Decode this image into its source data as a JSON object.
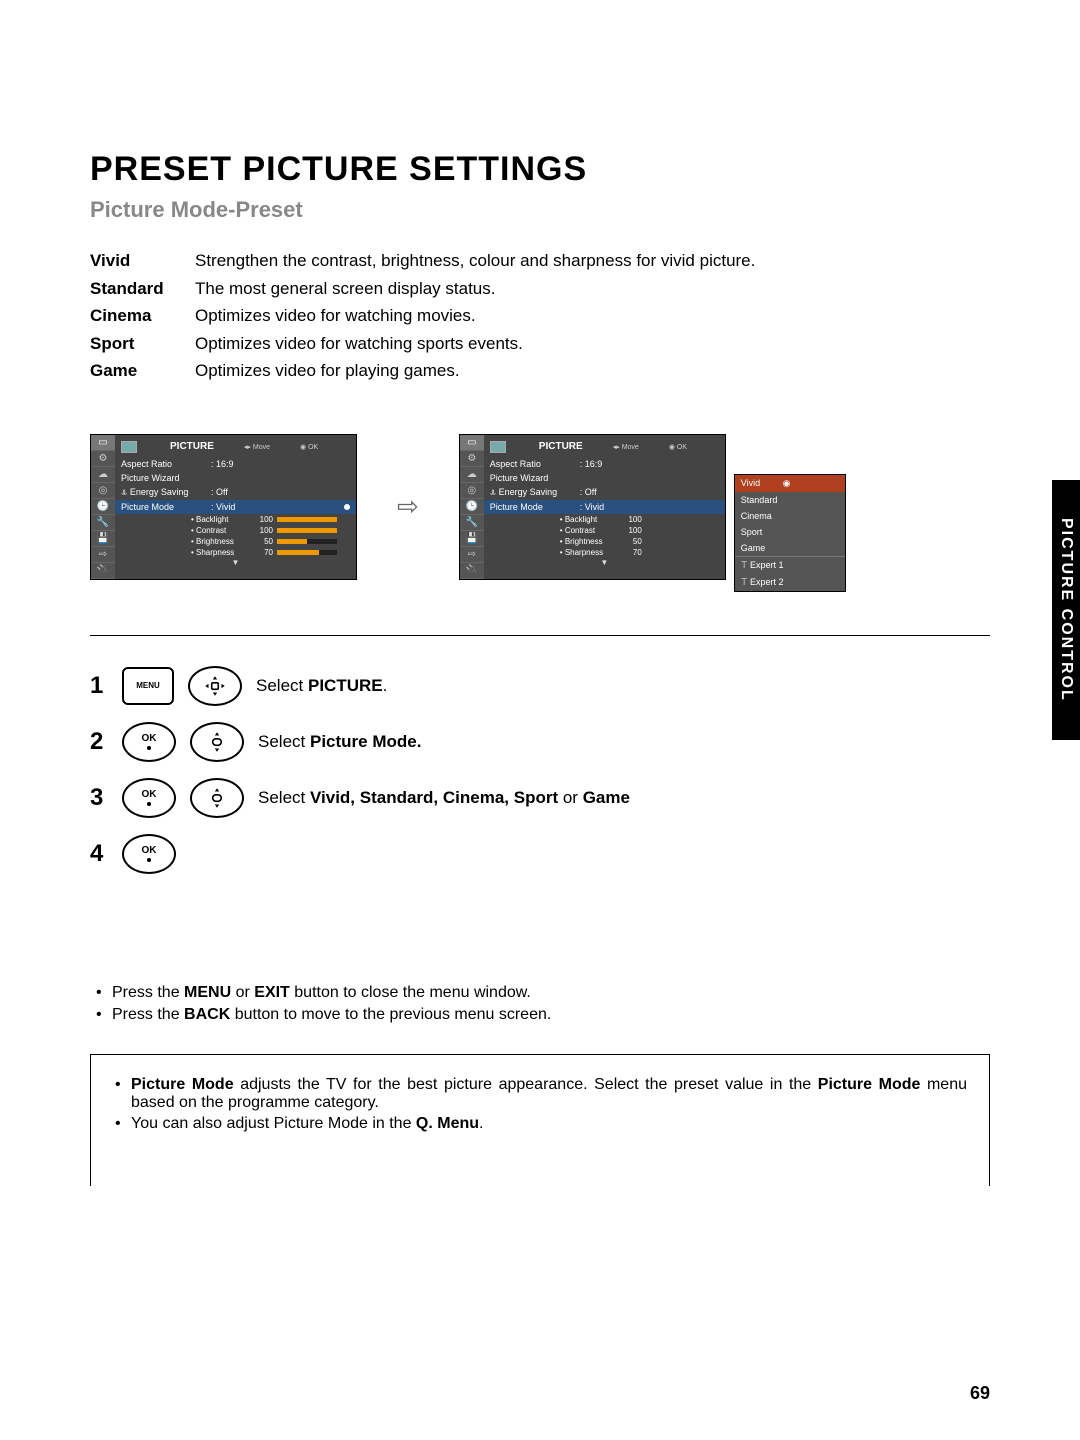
{
  "side_tab": "PICTURE CONTROL",
  "title": "PRESET PICTURE SETTINGS",
  "subtitle": "Picture Mode-Preset",
  "modes": [
    {
      "label": "Vivid",
      "desc": "Strengthen the contrast, brightness, colour and sharpness for vivid picture."
    },
    {
      "label": "Standard",
      "desc": "The most general screen display status."
    },
    {
      "label": "Cinema",
      "desc": "Optimizes video for watching movies."
    },
    {
      "label": "Sport",
      "desc": "Optimizes video for watching sports events."
    },
    {
      "label": "Game",
      "desc": "Optimizes video for playing games."
    }
  ],
  "osd": {
    "title": "PICTURE",
    "move": "Move",
    "ok": "OK",
    "items": [
      {
        "k": "Aspect Ratio",
        "v": ": 16:9"
      },
      {
        "k": "Picture Wizard",
        "v": ""
      },
      {
        "k": "ꕊ Energy Saving",
        "v": ": Off"
      },
      {
        "k": "Picture Mode",
        "v": ": Vivid",
        "hl": true
      }
    ],
    "sliders": [
      {
        "k": "• Backlight",
        "v": "100",
        "p": 100
      },
      {
        "k": "• Contrast",
        "v": "100",
        "p": 100
      },
      {
        "k": "• Brightness",
        "v": "50",
        "p": 50
      },
      {
        "k": "• Sharpness",
        "v": "70",
        "p": 70
      }
    ],
    "more": "▼"
  },
  "dropdown": [
    "Vivid",
    "Standard",
    "Cinema",
    "Sport",
    "Game",
    "ꔋ  Expert 1",
    "ꔋ  Expert 2"
  ],
  "arrow": "⇨",
  "steps": [
    {
      "n": "1",
      "btns": [
        "menu",
        "nav"
      ],
      "txt_pre": "Select ",
      "txt_b": "PICTURE",
      "txt_post": "."
    },
    {
      "n": "2",
      "btns": [
        "ok",
        "nav"
      ],
      "txt_pre": "Select ",
      "txt_b": "Picture Mode.",
      "txt_post": ""
    },
    {
      "n": "3",
      "btns": [
        "ok",
        "nav"
      ],
      "txt_pre": "Select ",
      "txt_b": "Vivid, Standard, Cinema, Sport",
      "txt_post": " or ",
      "txt_b2": "Game"
    },
    {
      "n": "4",
      "btns": [
        "ok"
      ],
      "txt_pre": "",
      "txt_b": "",
      "txt_post": ""
    }
  ],
  "btn_labels": {
    "menu": "MENU",
    "ok": "OK"
  },
  "notes": [
    {
      "pre": "Press the ",
      "b": "MENU",
      "mid": " or ",
      "b2": "EXIT",
      "post": " button to close the menu window."
    },
    {
      "pre": "Press the ",
      "b": "BACK",
      "mid": "",
      "b2": "",
      "post": "  button to move to the previous menu screen."
    }
  ],
  "notebox": [
    {
      "b": "Picture Mode",
      "mid": " adjusts the TV for the best picture appearance. Select the preset value in the ",
      "b2": "Picture Mode",
      "post": " menu based on the programme category."
    },
    {
      "pre": "You can also adjust Picture Mode in the ",
      "b": "Q. Menu",
      "post": "."
    }
  ],
  "page": "69"
}
